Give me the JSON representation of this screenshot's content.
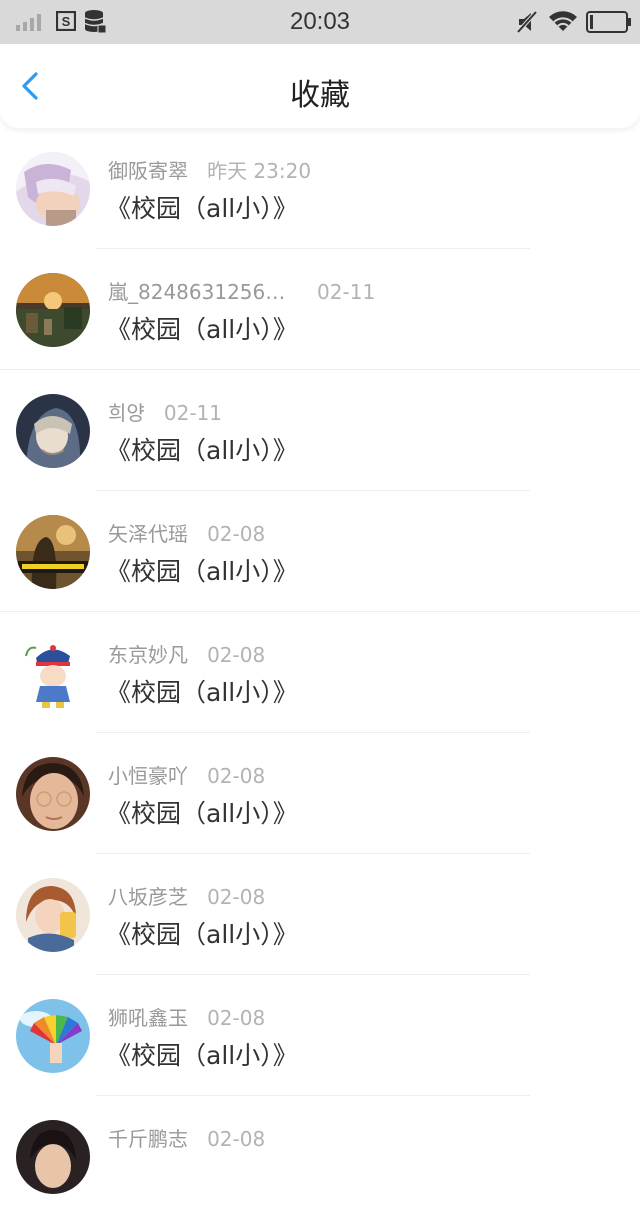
{
  "status_bar": {
    "time": "20:03",
    "icons": [
      "signal-icon",
      "sim-icon",
      "storage-icon",
      "mute-icon",
      "wifi-icon",
      "battery-icon"
    ]
  },
  "header": {
    "title": "收藏",
    "back_icon": "chevron-left-icon"
  },
  "colors": {
    "accent": "#2d9bf0",
    "status_bar_bg": "#d9d9d9",
    "name_text": "#999999",
    "time_text": "#b3b3b3",
    "content_text": "#333333",
    "divider": "#eeeeee"
  },
  "favorites": [
    {
      "name": "御阪寄翠",
      "time": "昨天 23:20",
      "content": "《校园（all小）》"
    },
    {
      "name": "嵐_8248631256…",
      "time": "02-11",
      "content": "《校园（all小）》"
    },
    {
      "name": "희양",
      "time": "02-11",
      "content": "《校园（all小）》"
    },
    {
      "name": "矢泽代瑶",
      "time": "02-08",
      "content": "《校园（all小）》"
    },
    {
      "name": "东京妙凡",
      "time": "02-08",
      "content": "《校园（all小）》"
    },
    {
      "name": "小恒豪吖",
      "time": "02-08",
      "content": "《校园（all小）》"
    },
    {
      "name": "八坂彦芝",
      "time": "02-08",
      "content": "《校园（all小）》"
    },
    {
      "name": "狮吼鑫玉",
      "time": "02-08",
      "content": "《校园（all小）》"
    },
    {
      "name": "千斤鹏志",
      "time": "02-08",
      "content": ""
    }
  ]
}
